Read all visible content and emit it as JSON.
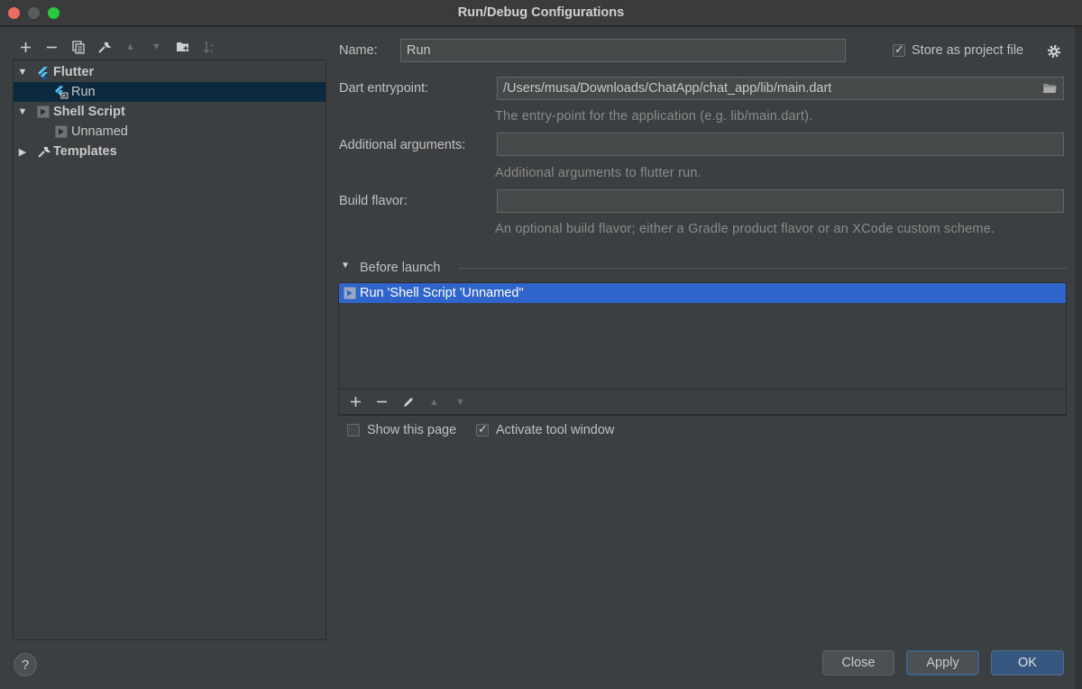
{
  "window": {
    "title": "Run/Debug Configurations"
  },
  "toolbar": {
    "add": "+",
    "remove": "−",
    "copy": "⧉",
    "wrench": "🔧",
    "up": "▲",
    "down": "▼",
    "folder": "📁",
    "sort": "↓a"
  },
  "tree": {
    "flutter": "Flutter",
    "run": "Run",
    "shell_script": "Shell Script",
    "unnamed": "Unnamed",
    "templates": "Templates"
  },
  "form": {
    "name_label": "Name:",
    "name_value": "Run",
    "store_label": "Store as project file",
    "store_checked": true,
    "entrypoint_label": "Dart entrypoint:",
    "entrypoint_value": "/Users/musa/Downloads/ChatApp/chat_app/lib/main.dart",
    "entrypoint_hint": "The entry-point for the application (e.g. lib/main.dart).",
    "args_label": "Additional arguments:",
    "args_value": "",
    "args_hint": "Additional arguments to flutter run.",
    "flavor_label": "Build flavor:",
    "flavor_value": "",
    "flavor_hint": "An optional build flavor; either a Gradle product flavor or an XCode custom scheme."
  },
  "before_launch": {
    "title": "Before launch",
    "items": [
      "Run 'Shell Script 'Unnamed''"
    ],
    "show_page_label": "Show this page",
    "show_page_checked": false,
    "activate_label": "Activate tool window",
    "activate_checked": true
  },
  "buttons": {
    "help": "?",
    "close": "Close",
    "apply": "Apply",
    "ok": "OK"
  },
  "colors": {
    "selection": "#2f65ca",
    "tree_selection": "#0d293e",
    "primary": "#365880"
  }
}
